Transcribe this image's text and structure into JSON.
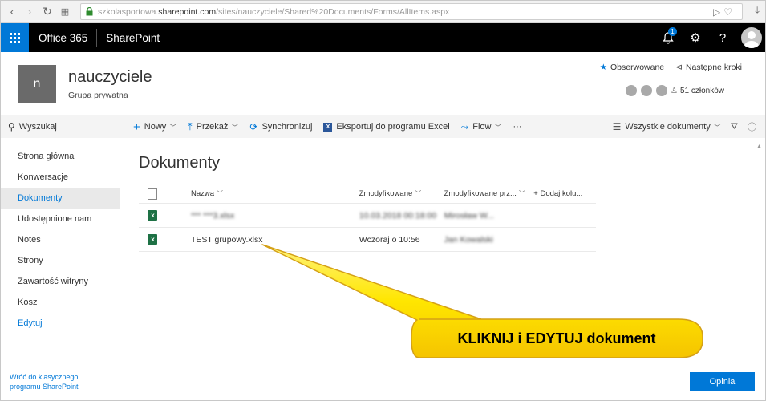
{
  "browser": {
    "url_prefix": "szkolasportowa.",
    "url_domain": "sharepoint.com",
    "url_path": "/sites/nauczyciele/Shared%20Documents/Forms/AllItems.aspx"
  },
  "suite": {
    "title": "Office 365",
    "app": "SharePoint",
    "notification_count": "1",
    "help": "?"
  },
  "site": {
    "logo_letter": "n",
    "title": "nauczyciele",
    "subtitle": "Grupa prywatna",
    "follow_label": "Obserwowane",
    "next_steps_label": "Następne kroki",
    "members_label": "51 członków"
  },
  "search": {
    "placeholder": "Wyszukaj"
  },
  "commands": {
    "new": "Nowy",
    "upload": "Przekaż",
    "sync": "Synchronizuj",
    "export": "Eksportuj do programu Excel",
    "flow": "Flow",
    "more": "···",
    "view": "Wszystkie dokumenty"
  },
  "nav": {
    "items": [
      "Strona główna",
      "Konwersacje",
      "Dokumenty",
      "Udostępnione nam",
      "Notes",
      "Strony",
      "Zawartość witryny",
      "Kosz",
      "Edytuj"
    ],
    "footer": "Wróć do klasycznego programu SharePoint"
  },
  "library": {
    "title": "Dokumenty",
    "columns": {
      "name": "Nazwa",
      "modified": "Zmodyfikowane",
      "modified_by": "Zmodyfikowane prz...",
      "add_column": "+ Dodaj kolu..."
    },
    "rows": [
      {
        "name": "*** ***3.xlsx",
        "modified": "10.03.2018 00:18:00",
        "modified_by": "Mirosław W..."
      },
      {
        "name": "TEST grupowy.xlsx",
        "modified": "Wczoraj o 10:56",
        "modified_by": "Jan Kowalski"
      }
    ]
  },
  "callout": {
    "text": "KLIKNIJ i EDYTUJ dokument",
    "fill": "#ffe600",
    "border": "#d4a017"
  },
  "feedback": {
    "label": "Opinia"
  },
  "colors": {
    "accent": "#0078d7",
    "suitebar": "#000000",
    "excel": "#1e7145"
  }
}
